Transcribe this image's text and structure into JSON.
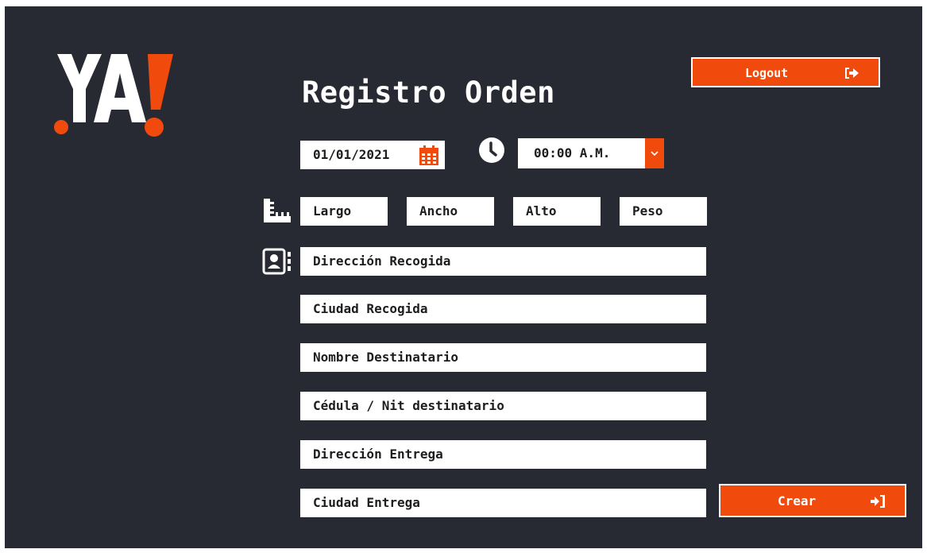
{
  "brand": {
    "logo_text": "YA!",
    "accent_color": "#f04a0d"
  },
  "header": {
    "title": "Registro Orden",
    "logout_label": "Logout",
    "logout_icon": "sign-out-icon"
  },
  "schedule": {
    "date_value": "01/01/2021",
    "date_icon": "calendar-icon",
    "time_icon": "clock-icon",
    "time_value": "00:00 A.M.",
    "time_caret_icon": "chevron-down-icon"
  },
  "dimensions": {
    "icon": "ruler-icon",
    "largo": "Largo",
    "ancho": "Ancho",
    "alto": "Alto",
    "peso": "Peso"
  },
  "addresses": {
    "icon": "contact-book-icon",
    "direccion_recogida": "Dirección Recogida",
    "ciudad_recogida": "Ciudad Recogida",
    "nombre_destinatario": "Nombre Destinatario",
    "cedula_nit": "Cédula / Nit destinatario",
    "direccion_entrega": "Dirección Entrega",
    "ciudad_entrega": "Ciudad Entrega"
  },
  "actions": {
    "crear_label": "Crear",
    "crear_icon": "sign-in-icon"
  }
}
